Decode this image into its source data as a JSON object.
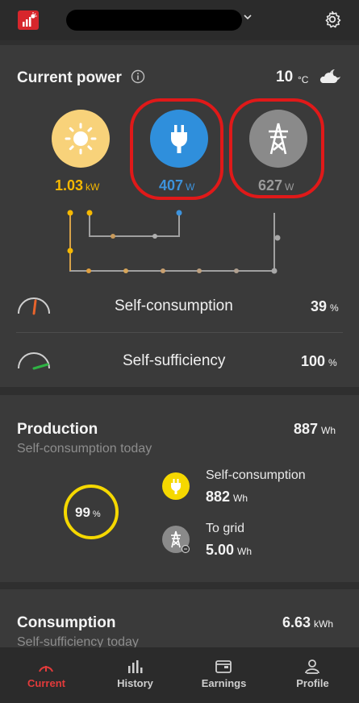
{
  "header": {
    "site_selector_icon": "chevron-down-icon",
    "settings_icon": "gear-icon",
    "logo_icon": "app-logo-icon"
  },
  "current_power": {
    "title": "Current power",
    "temperature": "10",
    "temperature_unit": "°C",
    "weather_icon": "cloud-night-icon",
    "sources": [
      {
        "name": "solar",
        "icon": "sun-icon",
        "value": "1.03",
        "unit": "kW",
        "color": "#f5b800"
      },
      {
        "name": "consumption",
        "icon": "plug-icon",
        "value": "407",
        "unit": "W",
        "color": "#3d93dc"
      },
      {
        "name": "grid",
        "icon": "power-tower-icon",
        "value": "627",
        "unit": "W",
        "color": "#9a9a9a"
      }
    ],
    "self_consumption": {
      "label": "Self-consumption",
      "value": "39",
      "unit": "%",
      "gauge_color": "#e8642c"
    },
    "self_sufficiency": {
      "label": "Self-sufficiency",
      "value": "100",
      "unit": "%",
      "gauge_color": "#2fb344"
    }
  },
  "production": {
    "title": "Production",
    "total": "887",
    "total_unit": "Wh",
    "subtitle": "Self-consumption today",
    "percent": "99",
    "percent_unit": "%",
    "percent_fraction": 0.99,
    "self_consumption": {
      "label": "Self-consumption",
      "value": "882",
      "unit": "Wh"
    },
    "to_grid": {
      "label": "To grid",
      "value": "5.00",
      "unit": "Wh"
    }
  },
  "consumption": {
    "title": "Consumption",
    "total": "6.63",
    "total_unit": "kWh",
    "subtitle": "Self-sufficiency today"
  },
  "nav": [
    {
      "label": "Current",
      "icon": "gauge-icon",
      "active": true
    },
    {
      "label": "History",
      "icon": "bar-chart-icon",
      "active": false
    },
    {
      "label": "Earnings",
      "icon": "wallet-icon",
      "active": false
    },
    {
      "label": "Profile",
      "icon": "person-icon",
      "active": false
    }
  ],
  "colors": {
    "accent": "#e33b3b",
    "solar": "#f5b800",
    "home": "#2f8fdc",
    "grid": "#8a8a8a",
    "highlight": "#e01919"
  }
}
